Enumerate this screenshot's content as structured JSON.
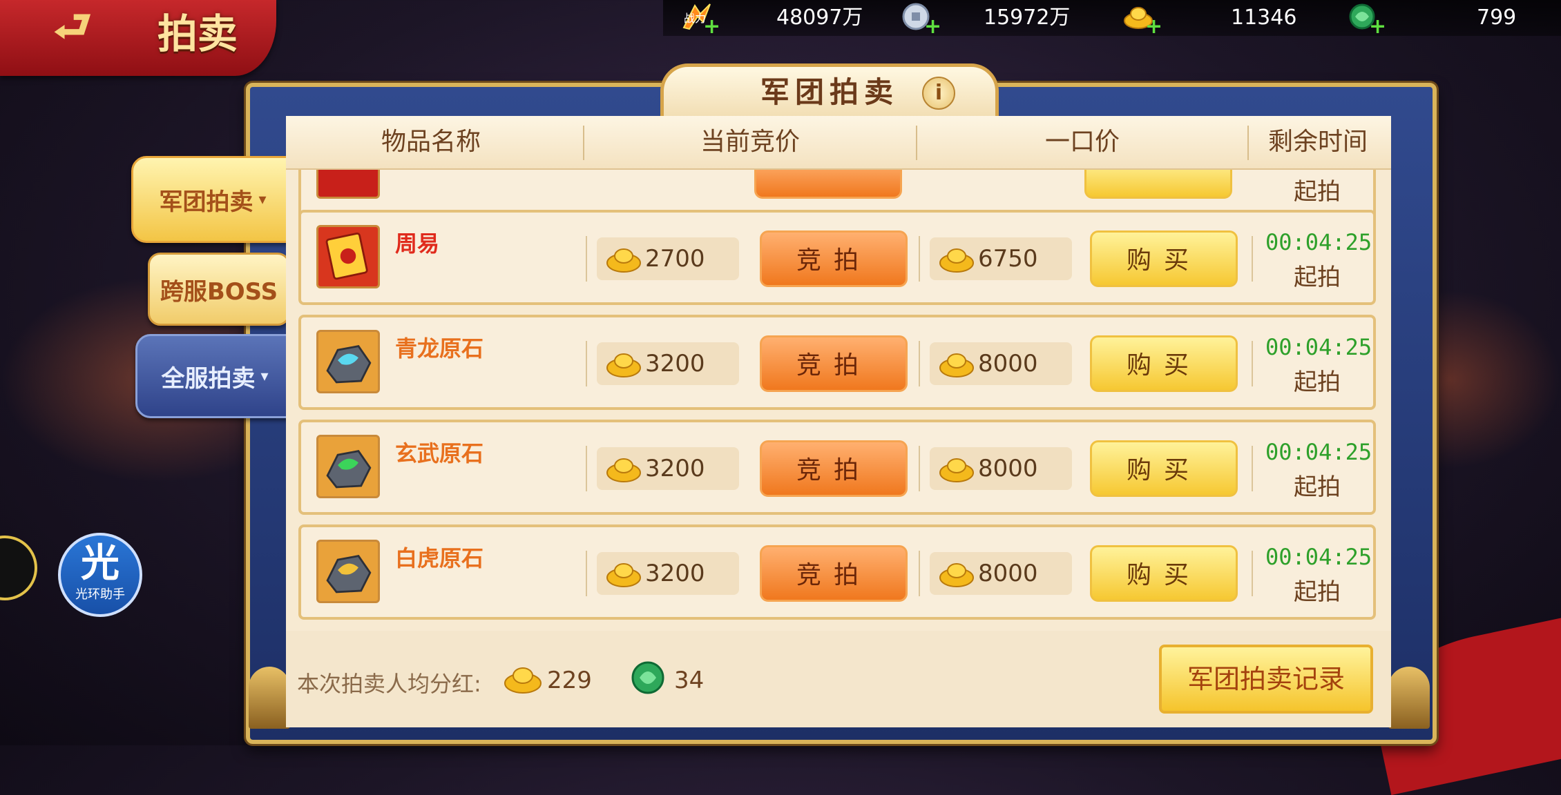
{
  "top_left": {
    "back_symbol": "⮐",
    "title": "拍卖"
  },
  "resources": [
    {
      "icon": "combat-power-icon",
      "label": "战力",
      "value": "48097万"
    },
    {
      "icon": "silver-coin-icon",
      "value": "15972万"
    },
    {
      "icon": "gold-ingot-icon",
      "value": "11346"
    },
    {
      "icon": "jade-token-icon",
      "value": "799"
    }
  ],
  "side_tabs": [
    {
      "label": "军团拍卖",
      "caret": "▾",
      "active": true
    },
    {
      "label": "跨服BOSS"
    },
    {
      "label": "全服拍卖",
      "caret": "▾"
    }
  ],
  "helper": {
    "big": "光",
    "small": "光环助手"
  },
  "panel": {
    "title": "军团拍卖",
    "info": "i",
    "columns": [
      "物品名称",
      "当前竞价",
      "一口价",
      "剩余时间"
    ]
  },
  "partial_row": {
    "time_status": "起拍"
  },
  "items": [
    {
      "name": "周易",
      "name_color": "#e02a1c",
      "icon": "book-icon",
      "current_bid": "2700",
      "buyout": "6750",
      "bid_label": "竞拍",
      "buy_label": "购买",
      "time": "00:04:25",
      "status": "起拍"
    },
    {
      "name": "青龙原石",
      "name_color": "#e8701e",
      "icon": "azure-dragon-stone-icon",
      "current_bid": "3200",
      "buyout": "8000",
      "bid_label": "竞拍",
      "buy_label": "购买",
      "time": "00:04:25",
      "status": "起拍"
    },
    {
      "name": "玄武原石",
      "name_color": "#e8701e",
      "icon": "black-tortoise-stone-icon",
      "current_bid": "3200",
      "buyout": "8000",
      "bid_label": "竞拍",
      "buy_label": "购买",
      "time": "00:04:25",
      "status": "起拍"
    },
    {
      "name": "白虎原石",
      "name_color": "#e8701e",
      "icon": "white-tiger-stone-icon",
      "current_bid": "3200",
      "buyout": "8000",
      "bid_label": "竞拍",
      "buy_label": "购买",
      "time": "00:04:25",
      "status": "起拍"
    }
  ],
  "footer": {
    "label": "本次拍卖人均分红:",
    "gold_value": "229",
    "jade_value": "34",
    "record_button": "军团拍卖记录"
  },
  "colors": {
    "accent_gold": "#f5c42c",
    "accent_orange": "#f0781e",
    "timer_green": "#2ea02a",
    "frame_blue": "#2a3f80"
  }
}
